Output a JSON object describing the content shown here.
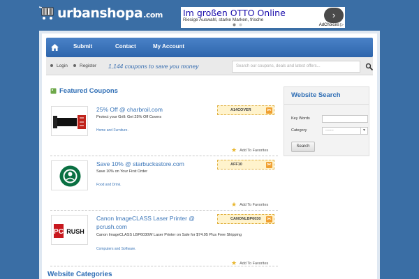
{
  "header": {
    "logo_main": "urbanshopa",
    "logo_domain": ".com"
  },
  "ad": {
    "title": "Im großen OTTO Online",
    "subtitle": "Riesige Auswahl, starke Marken, frische",
    "button_icon": "chevron-right-icon",
    "adchoices": "AdChoices ▷"
  },
  "nav": {
    "home_icon": "home-icon",
    "items": [
      "Submit",
      "Contact",
      "My Account"
    ]
  },
  "subbar": {
    "login": "Login",
    "register": "Register",
    "tagline": "1,144 coupons to save you money",
    "search_placeholder": "Search our coupons, deals and latest offers..."
  },
  "featured": {
    "heading": "Featured Coupons",
    "coupons": [
      {
        "store": "Char-Broil",
        "title": "25% Off @ charbroil.com",
        "description": "Protect your Grill: Get 25% Off Covers",
        "category": "Home and Furniture.",
        "code": "A14COVER",
        "favorite": "Add To Favorites"
      },
      {
        "store": "Starbucks",
        "title": "Save 10% @ starbucksstore.com",
        "description": "Save 10% on Your First Order",
        "category": "Food and Drink.",
        "code": "AFF10",
        "favorite": "Add To Favorites"
      },
      {
        "store": "PC Rush",
        "title": "Canon ImageCLASS Laser Printer @ pcrush.com",
        "description": "Canon ImageCLASS LBP6030W Laser Printer on Sale for $74.95 Plus Free Shipping",
        "category": "Computers and Software.",
        "code": "CANONLBP6030",
        "favorite": "Add To Favorites"
      }
    ]
  },
  "categories": {
    "heading": "Website Categories"
  },
  "sidebar": {
    "heading": "Website Search",
    "keywords_label": "Key Words",
    "category_label": "Category",
    "category_value": "-------",
    "search_button": "Search"
  },
  "colors": {
    "background": "#3a6ea5",
    "accent": "#2f6eb5",
    "code_bg": "#fff3cc",
    "scissor": "#f0a030"
  }
}
